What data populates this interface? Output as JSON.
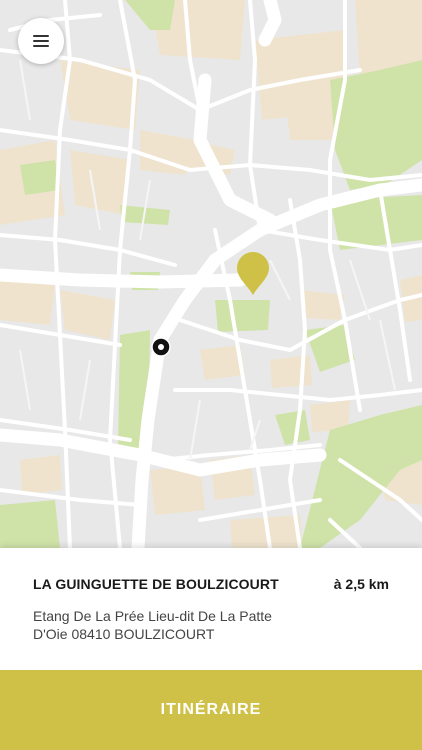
{
  "menu": {
    "icon": "hamburger-menu-icon"
  },
  "map": {
    "pin_icon": "location-pin-icon",
    "pin_color": "#cfc047",
    "user_location_icon": "user-location-dot-icon",
    "park_color": "#cfe3a9",
    "block_color": "#efe3ce",
    "road_color": "#ffffff"
  },
  "place": {
    "name": "LA GUINGUETTE DE BOULZICOURT",
    "distance": "à 2,5 km",
    "address": "Etang De La Prée Lieu-dit De La Patte D'Oie 08410 BOULZICOURT"
  },
  "cta": {
    "label": "ITINÉRAIRE",
    "color": "#cfc047"
  }
}
